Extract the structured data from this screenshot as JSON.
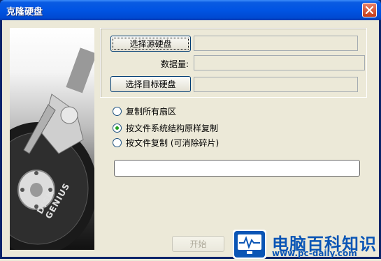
{
  "window": {
    "title": "克隆硬盘"
  },
  "image_panel": {
    "brand": "DISK GENIUS"
  },
  "buttons": {
    "select_source": "选择源硬盘",
    "select_target": "选择目标硬盘",
    "start": "开始"
  },
  "fields": {
    "data_amount_label": "数据量:",
    "source_value": "",
    "data_amount_value": "",
    "target_value": ""
  },
  "options": [
    {
      "label": "复制所有扇区",
      "selected": false
    },
    {
      "label": "按文件系统结构原样复制",
      "selected": true
    },
    {
      "label": "按文件复制 (可消除碎片)",
      "selected": false
    }
  ],
  "watermark": {
    "title": "电脑百科知识",
    "url": "www.pc-daily.com"
  },
  "colors": {
    "titlebar": "#0054e3",
    "dialog_bg": "#ece9d8",
    "watermark": "#0a55b5"
  }
}
